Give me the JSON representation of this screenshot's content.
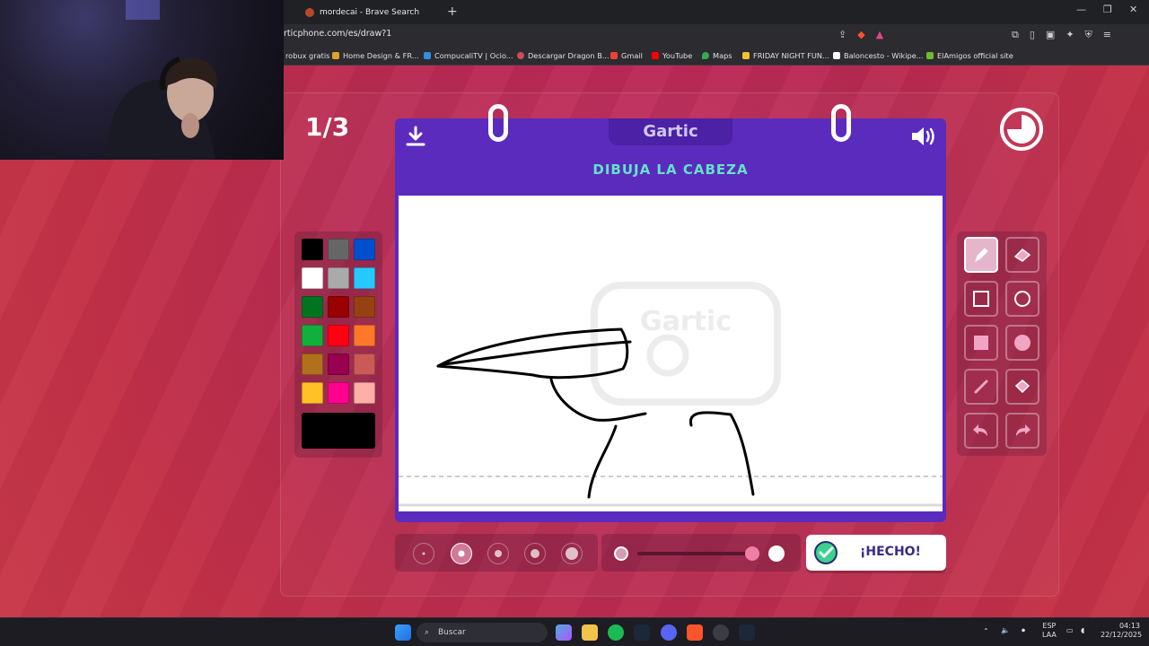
{
  "browser": {
    "tab_title": "mordecai - Brave Search",
    "url": "rticphone.com/es/draw?1",
    "bookmarks": [
      "robux gratis",
      "Home Design & FR...",
      "CompucaliTV | Ocio...",
      "Descargar Dragon B...",
      "Gmail",
      "YouTube",
      "Maps",
      "FRIDAY NIGHT FUN...",
      "Baloncesto - Wikipe...",
      "ElAmigos official site"
    ]
  },
  "game": {
    "round": "1/3",
    "logo": "Gartic",
    "prompt": "DIBUJA LA CABEZA",
    "watermark": "Gartic PHONE",
    "done_label": "¡HECHO!"
  },
  "palette": {
    "colors": [
      "#000000",
      "#666666",
      "#0050cd",
      "#ffffff",
      "#aaaaaa",
      "#26c9ff",
      "#017420",
      "#990000",
      "#964112",
      "#11b03c",
      "#ff0013",
      "#ff7829",
      "#b0701c",
      "#99004e",
      "#cb5a57",
      "#ffc126",
      "#ff008f",
      "#feafa8"
    ],
    "current": "#000000"
  },
  "tools": [
    "pencil-icon",
    "eraser-icon",
    "rectangle-outline-icon",
    "ellipse-outline-icon",
    "rectangle-fill-icon",
    "ellipse-fill-icon",
    "line-icon",
    "bucket-icon",
    "undo-icon",
    "redo-icon"
  ],
  "brush_sizes": {
    "count": 5,
    "selected_index": 1
  },
  "opacity": {
    "value": 1.0
  },
  "taskbar": {
    "search_placeholder": "Buscar",
    "lang_top": "ESP",
    "lang_bottom": "LAA",
    "time": "04:13",
    "date": "22/12/2025"
  }
}
